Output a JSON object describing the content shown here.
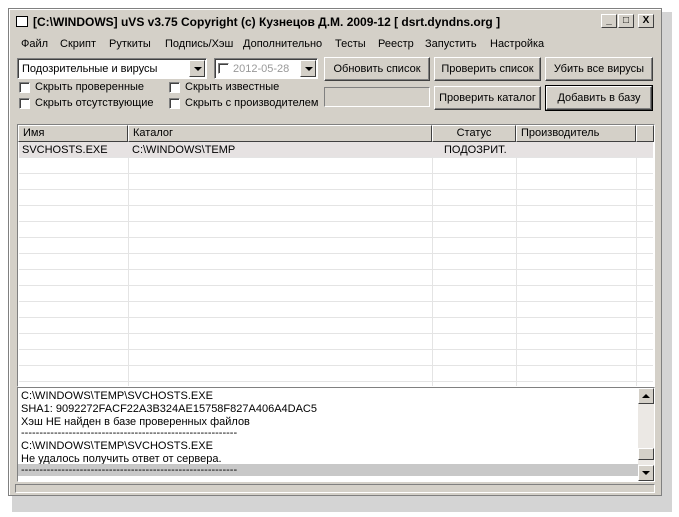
{
  "window": {
    "title": "[C:\\WINDOWS] uVS v3.75 Copyright (c) Кузнецов Д.М. 2009-12 [ dsrt.dyndns.org ]",
    "controls": {
      "minimize": "_",
      "maximize": "□",
      "close": "X"
    }
  },
  "menu": [
    "Файл",
    "Скрипт",
    "Руткиты",
    "Подпись/Хэш",
    "Дополнительно",
    "Тесты",
    "Реестр",
    "Запустить",
    "Настройка"
  ],
  "toolbar": {
    "filter_value": "Подозрительные и вирусы",
    "date_value": "2012-05-28",
    "refresh_list": "Обновить список",
    "check_list": "Проверить список",
    "kill_viruses": "Убить все вирусы",
    "check_folder": "Проверить каталог",
    "add_to_db": "Добавить в базу"
  },
  "checkboxes": {
    "hide_checked": "Скрыть проверенные",
    "hide_known": "Скрыть известные",
    "hide_missing": "Скрыть отсутствующие",
    "hide_with_vendor": "Скрыть с производителем"
  },
  "table": {
    "columns": [
      "Имя",
      "Каталог",
      "Статус",
      "Производитель"
    ],
    "rows": [
      {
        "name": "SVCHOSTS.EXE",
        "folder": "C:\\WINDOWS\\TEMP",
        "status": "ПОДОЗРИТ.",
        "vendor": ""
      }
    ]
  },
  "log": [
    "C:\\WINDOWS\\TEMP\\SVCHOSTS.EXE",
    "SHA1: 9092272FACF22A3B324AE15758F827A406A4DAC5",
    "Хэш НЕ найден в базе проверенных файлов",
    "-----------------------------------------------------------",
    "C:\\WINDOWS\\TEMP\\SVCHOSTS.EXE",
    "Не удалось получить ответ от сервера.",
    "-----------------------------------------------------------"
  ]
}
